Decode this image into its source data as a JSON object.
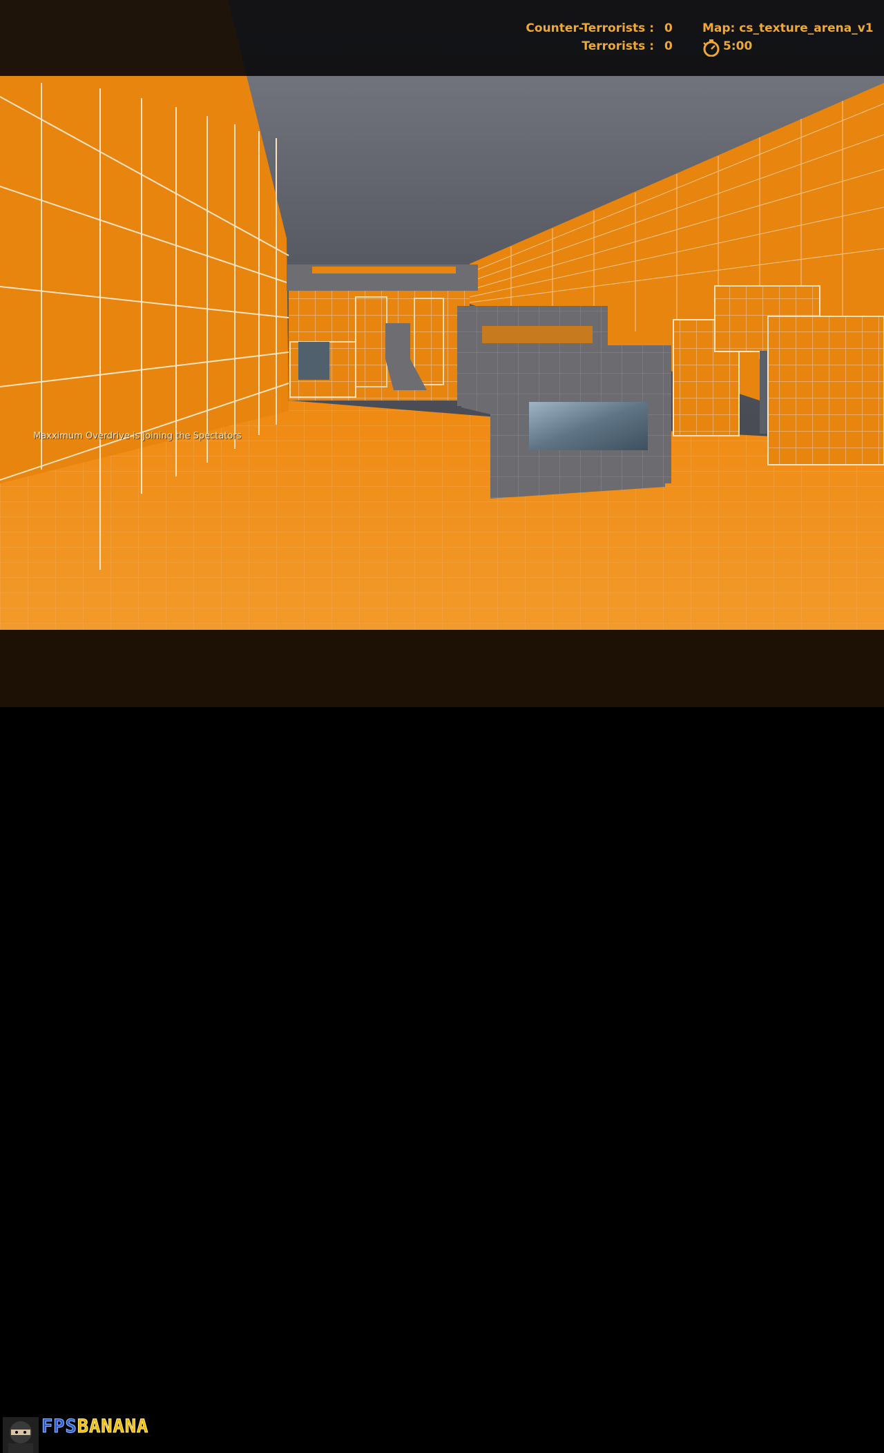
{
  "hud": {
    "ct_label": "Counter-Terrorists :",
    "ct_score": "0",
    "t_label": "Terrorists :",
    "t_score": "0",
    "map": "Map: cs_texture_arena_v1",
    "timer": "5:00",
    "timer_icon": "stopwatch-icon"
  },
  "chat": {
    "message": "Maxximum Overdrive is joining the Spectators"
  },
  "logo": {
    "fps": "FPS",
    "banana": "BANANA",
    "avatar_icon": "ninja-avatar-icon"
  },
  "colors": {
    "hud_text": "#f0a830",
    "orange_wall": "#e8870f",
    "floor": "#ef8c14",
    "grey_block": "#6e6e72",
    "sky": "#4a4d55"
  }
}
